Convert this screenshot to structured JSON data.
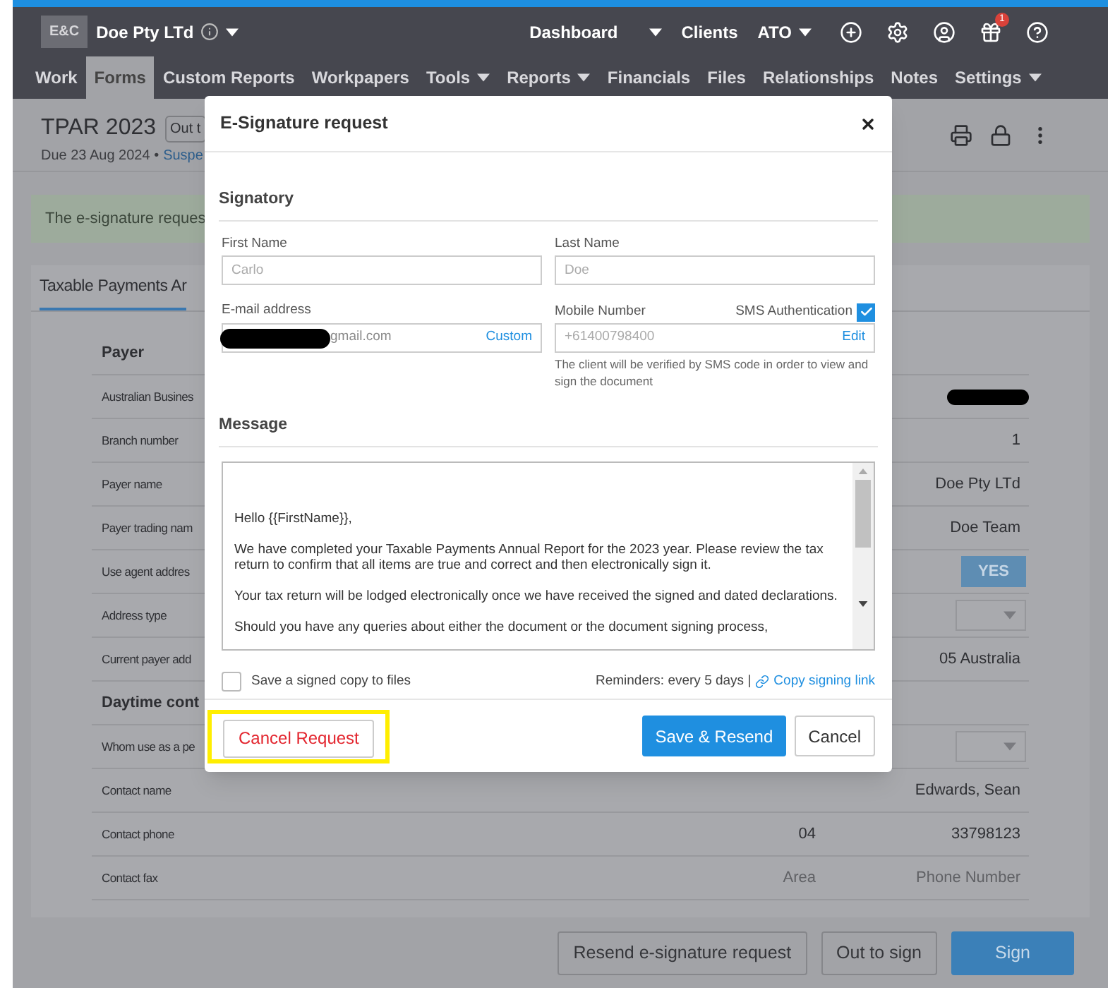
{
  "header": {
    "logo": "E&C",
    "company": "Doe Pty LTd",
    "links": [
      {
        "label": "Dashboard",
        "dropdown": true
      },
      {
        "label": "Clients",
        "dropdown": false
      },
      {
        "label": "ATO",
        "dropdown": true
      }
    ],
    "notification_count": "1"
  },
  "nav": [
    {
      "label": "Work",
      "selected": false,
      "dropdown": false
    },
    {
      "label": "Forms",
      "selected": true,
      "dropdown": false
    },
    {
      "label": "Custom Reports",
      "selected": false,
      "dropdown": false
    },
    {
      "label": "Workpapers",
      "selected": false,
      "dropdown": false
    },
    {
      "label": "Tools",
      "selected": false,
      "dropdown": true
    },
    {
      "label": "Reports",
      "selected": false,
      "dropdown": true
    },
    {
      "label": "Financials",
      "selected": false,
      "dropdown": false
    },
    {
      "label": "Files",
      "selected": false,
      "dropdown": false
    },
    {
      "label": "Relationships",
      "selected": false,
      "dropdown": false
    },
    {
      "label": "Notes",
      "selected": false,
      "dropdown": false
    },
    {
      "label": "Settings",
      "selected": false,
      "dropdown": true
    }
  ],
  "page": {
    "title": "TPAR 2023",
    "status_button": "Out t",
    "due": "Due 23 Aug 2024 •",
    "status_link": "Suspe"
  },
  "alert": "The e-signature reques",
  "card": {
    "tab": "Taxable Payments Ar",
    "sections": [
      {
        "heading": "Payer",
        "rows": [
          {
            "label": "Australian Busines",
            "kind": "redacted"
          },
          {
            "label": "Branch number",
            "kind": "text",
            "value": "1"
          },
          {
            "label": "Payer name",
            "kind": "text",
            "value": "Doe Pty LTd"
          },
          {
            "label": "Payer trading nam",
            "kind": "text",
            "value": "Doe Team"
          },
          {
            "label": "Use agent addres",
            "kind": "toggle",
            "value": "YES"
          },
          {
            "label": "Address type",
            "kind": "select"
          },
          {
            "label": "Current payer add",
            "kind": "text",
            "value": "05 Australia"
          }
        ]
      },
      {
        "heading": "Daytime cont",
        "rows": [
          {
            "label": "Whom use as a pe",
            "kind": "select"
          },
          {
            "label": "Contact name",
            "kind": "text",
            "value": "Edwards, Sean"
          },
          {
            "label": "Contact phone",
            "kind": "phone",
            "area": {
              "value": "04"
            },
            "number": {
              "value": "33798123"
            }
          },
          {
            "label": "Contact fax",
            "kind": "phone",
            "area": {
              "placeholder": "Area"
            },
            "number": {
              "placeholder": "Phone Number"
            }
          }
        ]
      }
    ]
  },
  "footer_buttons": [
    {
      "label": "Resend e-signature request",
      "primary": false
    },
    {
      "label": "Out to sign",
      "primary": false
    },
    {
      "label": "Sign",
      "primary": true
    }
  ],
  "modal": {
    "title": "E-Signature request",
    "signatory_heading": "Signatory",
    "first_name": {
      "label": "First Name",
      "placeholder": "Carlo"
    },
    "last_name": {
      "label": "Last Name",
      "placeholder": "Doe"
    },
    "email": {
      "label": "E-mail address",
      "value": "gmail.com",
      "redacted": true,
      "action": "Custom"
    },
    "mobile": {
      "label": "Mobile Number",
      "placeholder": "+61400798400",
      "action": "Edit",
      "sms_label": "SMS Authentication",
      "sms_checked": true,
      "hint": "The client will be verified by SMS code in order to view and sign the document"
    },
    "message_heading": "Message",
    "message": [
      "Hello {{FirstName}},",
      "We have completed your Taxable Payments Annual Report for the 2023 year. Please review the tax return to confirm that all items are true and correct and then electronically sign it.",
      "Your tax return will be lodged electronically once we have received the signed and dated declarations.",
      "Should you have any queries about either the document or the document signing process,"
    ],
    "save_copy": {
      "label": "Save a signed copy to files",
      "checked": false
    },
    "reminders": "Reminders: every 5 days |",
    "copy_link": "Copy signing link",
    "cancel_request": {
      "label": "Cancel Request",
      "highlighted": true
    },
    "buttons": [
      {
        "label": "Save & Resend",
        "primary": true
      },
      {
        "label": "Cancel",
        "primary": false
      }
    ]
  }
}
